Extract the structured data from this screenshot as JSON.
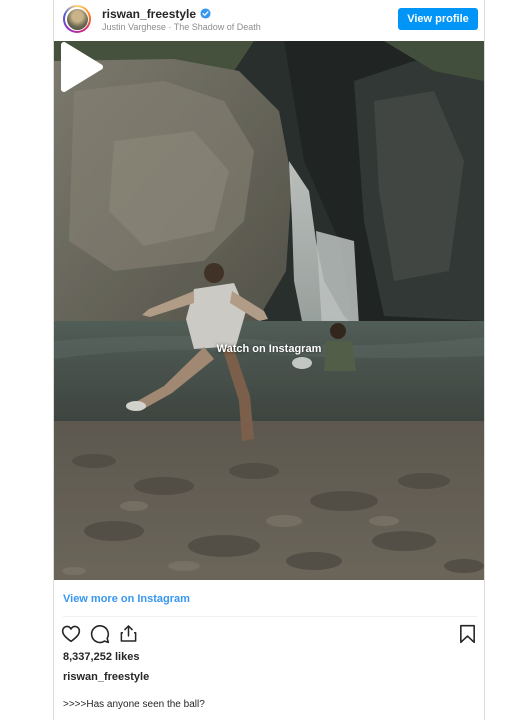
{
  "header": {
    "username": "riswan_freestyle",
    "subtitle": "Justin Varghese · The Shadow of Death",
    "view_profile_label": "View profile"
  },
  "media": {
    "watch_label": "Watch on Instagram"
  },
  "footer": {
    "view_more_label": "View more on Instagram",
    "likes": "8,337,252 likes",
    "caption_user": "riswan_freestyle",
    "caption": ">>>>Has anyone seen the ball?"
  },
  "icons": {
    "verified": "verified-badge-icon",
    "like": "heart-icon",
    "comment": "comment-icon",
    "share": "share-icon",
    "save": "bookmark-icon",
    "play": "play-icon"
  },
  "colors": {
    "primary_button": "#0095f6",
    "link": "#3897f0",
    "text": "#262626",
    "muted": "#8e8e8e"
  }
}
